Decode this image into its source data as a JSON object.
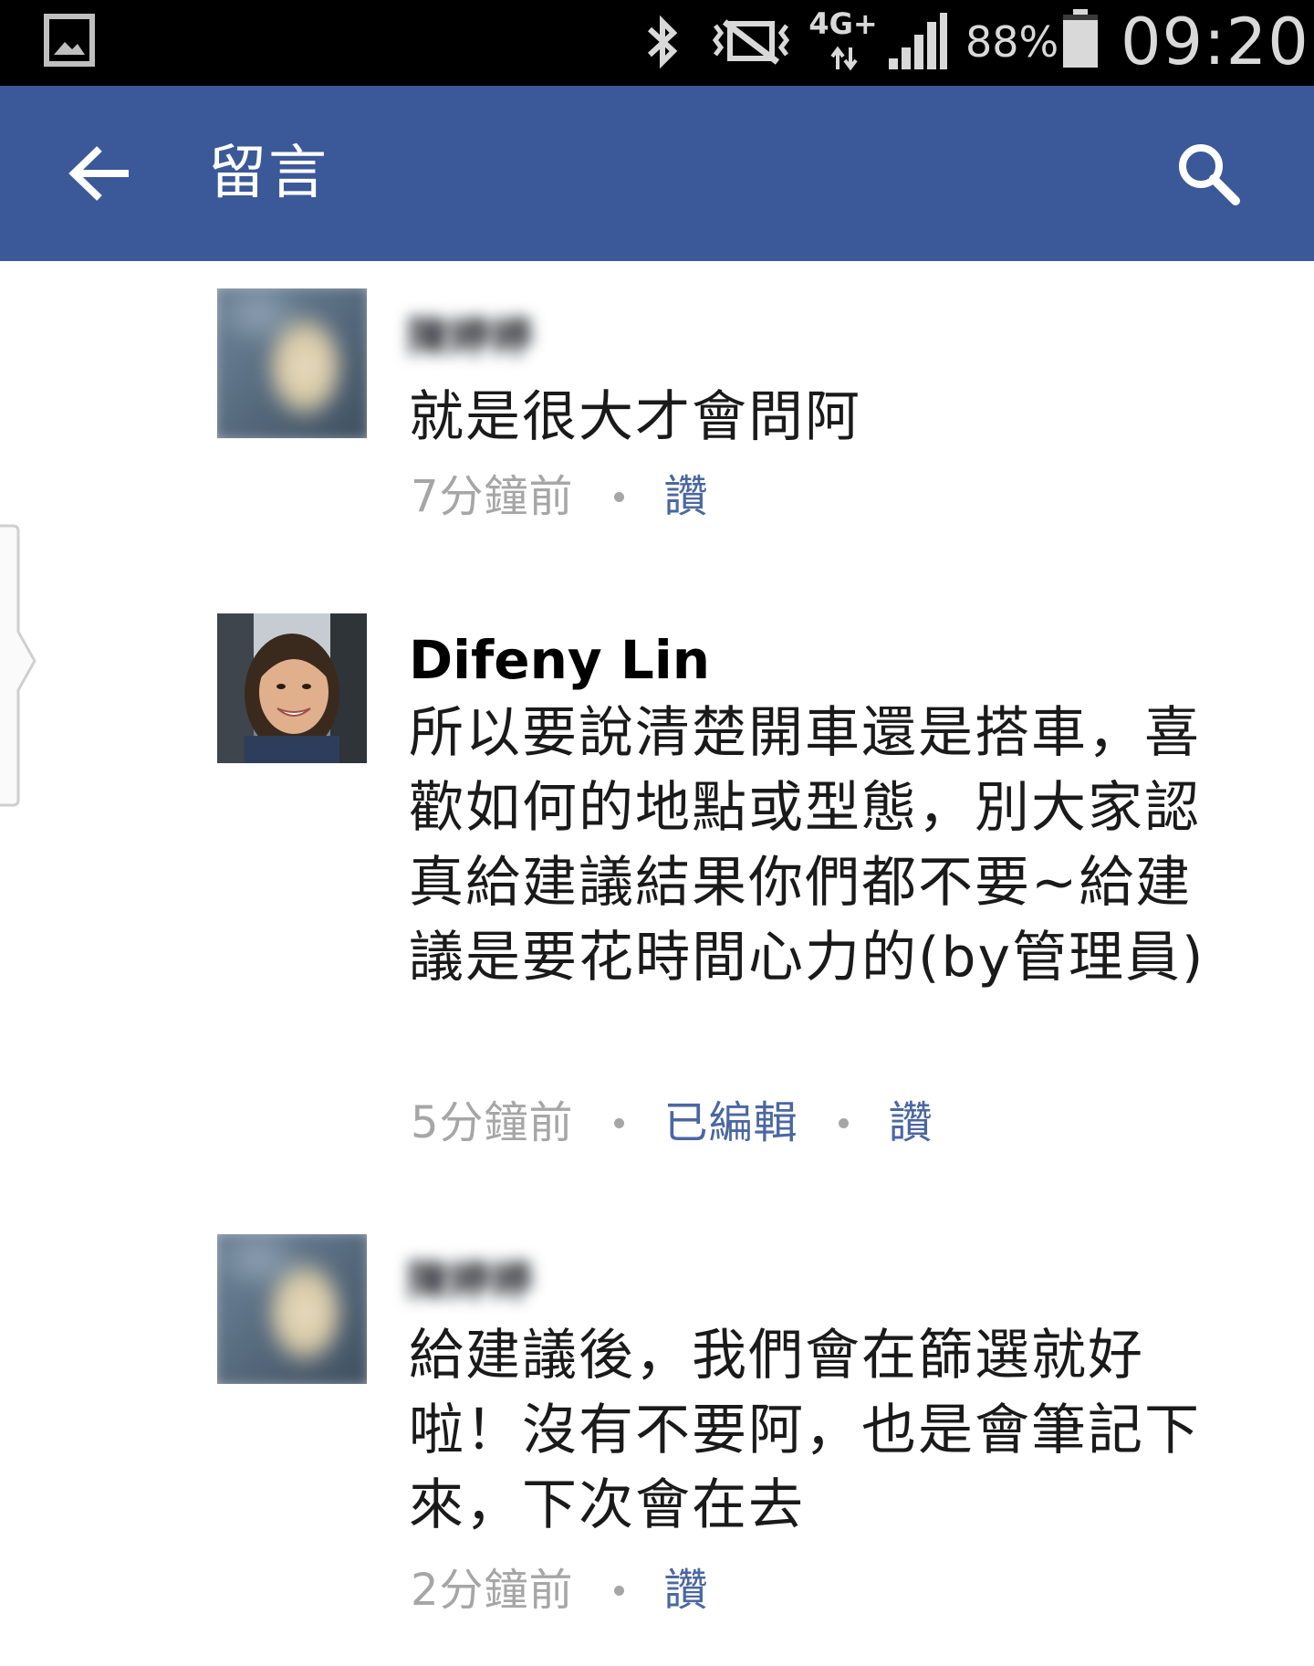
{
  "status_bar": {
    "network": "4G+",
    "battery": "88%",
    "time": "09:20",
    "icons": [
      "gallery-icon",
      "bluetooth-icon",
      "vibrate-mute-icon",
      "network-4g-icon",
      "signal-icon",
      "battery-icon"
    ]
  },
  "app_bar": {
    "title": "留言",
    "back_icon": "arrow-left-icon",
    "search_icon": "search-icon",
    "background": "#3b5998"
  },
  "comments": [
    {
      "author": "陳婷婷",
      "author_blurred": true,
      "text": "就是很大才會問阿",
      "time": "7分鐘前",
      "actions": [
        "讚"
      ]
    },
    {
      "author": "Difeny Lin",
      "author_blurred": false,
      "text": "所以要說清楚開車還是搭車，喜歡如何的地點或型態，別大家認真給建議結果你們都不要~給建議是要花時間心力的(by管理員)",
      "time": "5分鐘前",
      "actions": [
        "已編輯",
        "讚"
      ]
    },
    {
      "author": "陳婷婷",
      "author_blurred": true,
      "text": "給建議後，我們會在篩選就好啦！沒有不要阿，也是會筆記下來，下次會在去",
      "time": "2分鐘前",
      "actions": [
        "讚"
      ]
    }
  ],
  "colors": {
    "link": "#4b67a1",
    "meta": "#a6a6a6",
    "text": "#1a1a1a"
  }
}
